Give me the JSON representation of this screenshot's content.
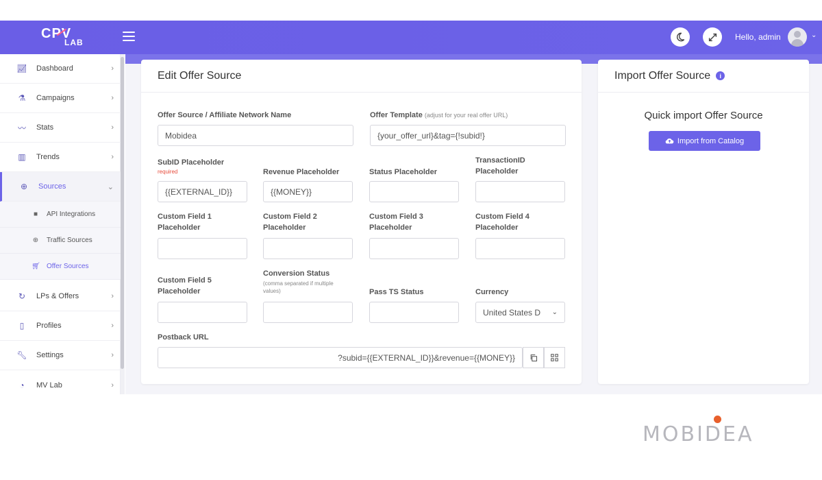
{
  "header": {
    "logo_main": "CPV",
    "logo_sub": "LAB",
    "greeting": "Hello, admin",
    "theme_icon": "moon-icon",
    "fullscreen_icon": "expand-icon",
    "menu_icon": "hamburger-icon"
  },
  "sidebar": {
    "items": [
      {
        "label": "Dashboard",
        "icon": "chart-line-icon"
      },
      {
        "label": "Campaigns",
        "icon": "flask-icon"
      },
      {
        "label": "Stats",
        "icon": "stats-icon"
      },
      {
        "label": "Trends",
        "icon": "calendar-icon"
      },
      {
        "label": "Sources",
        "icon": "globe-icon"
      },
      {
        "label": "LPs & Offers",
        "icon": "redo-icon"
      },
      {
        "label": "Profiles",
        "icon": "clipboard-icon"
      },
      {
        "label": "Settings",
        "icon": "wrench-icon"
      },
      {
        "label": "MV Lab",
        "icon": "gauge-icon"
      }
    ],
    "sub_items": [
      {
        "label": "API Integrations",
        "icon": "folder-icon"
      },
      {
        "label": "Traffic Sources",
        "icon": "globe-icon"
      },
      {
        "label": "Offer Sources",
        "icon": "cart-icon"
      }
    ]
  },
  "edit_card": {
    "title": "Edit Offer Source",
    "name_label": "Offer Source / Affiliate Network Name",
    "name_value": "Mobidea",
    "template_label": "Offer Template",
    "template_hint": "(adjust for your real offer URL)",
    "template_value": "{your_offer_url}&tag={!subid!}",
    "subid_label": "SubID Placeholder",
    "subid_required": "required",
    "subid_value": "{{EXTERNAL_ID}}",
    "revenue_label": "Revenue Placeholder",
    "revenue_value": "{{MONEY}}",
    "status_label": "Status Placeholder",
    "transaction_label_1": "TransactionID",
    "transaction_label_2": "Placeholder",
    "cf1_label_1": "Custom Field 1",
    "cf2_label_1": "Custom Field 2",
    "cf3_label_1": "Custom Field 3",
    "cf4_label_1": "Custom Field 4",
    "cf5_label_1": "Custom Field 5",
    "placeholder_word": "Placeholder",
    "conversion_label": "Conversion Status",
    "conversion_hint_1": "(comma separated if multiple",
    "conversion_hint_2": "values)",
    "pass_ts_label": "Pass TS Status",
    "currency_label": "Currency",
    "currency_value": "United States D",
    "postback_label": "Postback URL",
    "postback_value": "?subid={{EXTERNAL_ID}}&revenue={{MONEY}}",
    "copy_icon": "copy-icon",
    "qr_icon": "qr-icon"
  },
  "import_card": {
    "title": "Import Offer Source",
    "subtitle": "Quick import Offer Source",
    "button_label": "Import from Catalog",
    "button_icon": "cloud-upload-icon"
  },
  "watermark": {
    "text": "MOBIDEA"
  },
  "colors": {
    "accent": "#6c63e8",
    "header": "#6a5ee6",
    "required": "#e74c3c",
    "watermark_dot": "#e8602c"
  }
}
